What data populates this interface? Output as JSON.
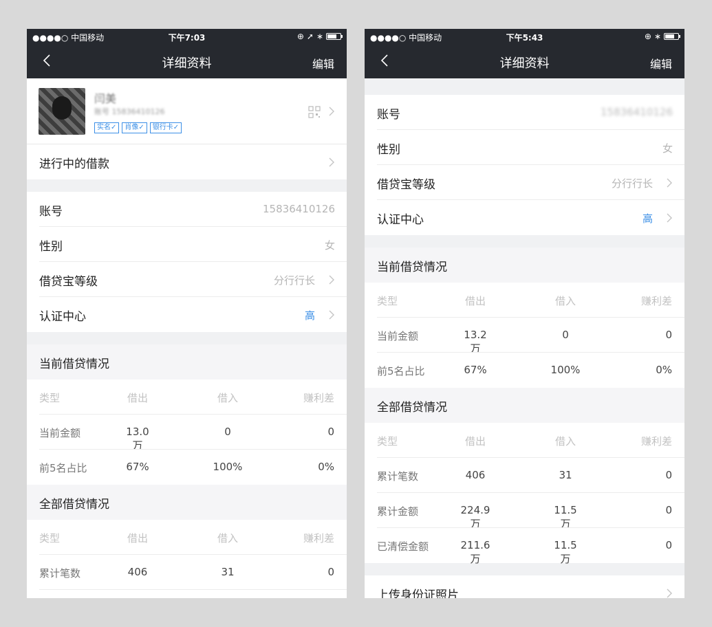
{
  "colors": {
    "navbar": "#26292f",
    "accent": "#3a8ee6",
    "muted": "#b5b5b5"
  },
  "phone1": {
    "status": {
      "carrier": "●●●●○ 中国移动",
      "time": "下午7:03"
    },
    "nav": {
      "title": "详细资料",
      "edit": "编辑"
    },
    "profile": {
      "name": "闫美",
      "id_text": "账号 15836410126",
      "badges": [
        "实名✓",
        "肖像✓",
        "银行卡✓"
      ]
    },
    "loan_row": "进行中的借款",
    "account": {
      "label": "账号",
      "value": "15836410126"
    },
    "gender": {
      "label": "性别",
      "value": "女"
    },
    "level": {
      "label": "借贷宝等级",
      "value": "分行行长"
    },
    "cert": {
      "label": "认证中心",
      "value": "高"
    },
    "current": {
      "title": "当前借贷情况",
      "header": [
        "类型",
        "借出",
        "借入",
        "赚利差"
      ],
      "rows": [
        [
          "当前金额",
          "13.0万",
          "0",
          "0"
        ],
        [
          "前5名占比",
          "67%",
          "100%",
          "0%"
        ]
      ]
    },
    "all": {
      "title": "全部借贷情况",
      "header": [
        "类型",
        "借出",
        "借入",
        "赚利差"
      ],
      "rows": [
        [
          "累计笔数",
          "406",
          "31",
          "0"
        ]
      ]
    }
  },
  "phone2": {
    "status": {
      "carrier": "●●●●○ 中国移动",
      "time": "下午5:43"
    },
    "nav": {
      "title": "详细资料",
      "edit": "编辑"
    },
    "account": {
      "label": "账号",
      "value": "15836410126"
    },
    "gender": {
      "label": "性别",
      "value": "女"
    },
    "level": {
      "label": "借贷宝等级",
      "value": "分行行长"
    },
    "cert": {
      "label": "认证中心",
      "value": "高"
    },
    "current": {
      "title": "当前借贷情况",
      "header": [
        "类型",
        "借出",
        "借入",
        "赚利差"
      ],
      "rows": [
        [
          "当前金额",
          "13.2万",
          "0",
          "0"
        ],
        [
          "前5名占比",
          "67%",
          "100%",
          "0%"
        ]
      ]
    },
    "all": {
      "title": "全部借贷情况",
      "header": [
        "类型",
        "借出",
        "借入",
        "赚利差"
      ],
      "rows": [
        [
          "累计笔数",
          "406",
          "31",
          "0"
        ],
        [
          "累计金额",
          "224.9万",
          "11.5万",
          "0"
        ],
        [
          "已清偿金额",
          "211.6万",
          "11.5万",
          "0"
        ]
      ]
    },
    "upload": "上传身份证照片"
  }
}
